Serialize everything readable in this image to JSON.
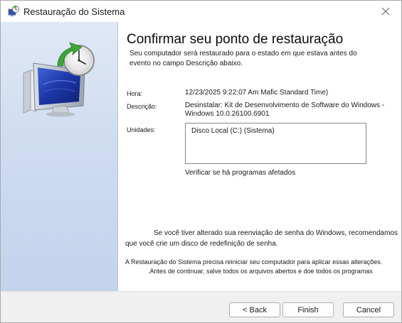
{
  "window": {
    "title": "Restauração do Sistema"
  },
  "main": {
    "heading": "Confirmar seu ponto de restauração",
    "subtitle": "Seu computador será restaurado para o estado em que estava antes do evento no campo Descrição abaixo.",
    "fields": {
      "time_label": "Hora:",
      "time_value": "12/23/2025 9:22:07 Am Mafic Standard Time)",
      "description_label": "Descrição:",
      "description_value": "Desinstalar: Kit de Desenvolvimento de Software do Windows - Windows 10.0.26100.6901",
      "drives_label": "Unidades:",
      "drives_value": "Disco Local (C:) (Sistema)"
    },
    "affected_link": "Verificar se há programas afetados",
    "password_note_line1": "Se você tiver alterado sua reenviação de senha do Windows, recomendamos",
    "password_note_line2": "que você crie um disco de redefinição de senha.",
    "restart_note_line1": "A Restauração do Sistema precisa reiniciar seu computador para aplicar essas alterações.",
    "restart_note_line2": ".Antes de continuar, salve todos os arquivos abertos e doe todos os programas"
  },
  "buttons": {
    "back": "< Back",
    "finish": "Finish",
    "cancel": "Cancel"
  },
  "icons": {
    "title": "system-restore-icon",
    "close": "close-icon",
    "hero": "computer-restore-clock-icon"
  },
  "colors": {
    "left_panel": "#cfdcf0",
    "screen_blue": "#1f3fae",
    "arrow_green": "#3fa535"
  }
}
